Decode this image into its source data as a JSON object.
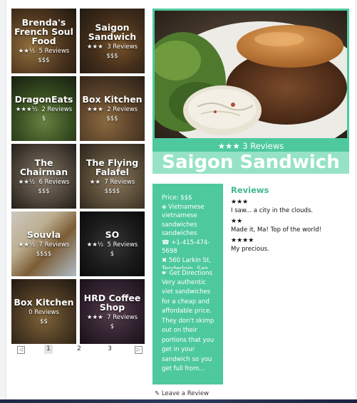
{
  "restaurants": [
    {
      "name": "Brenda's French Soul Food",
      "stars": "★★½",
      "reviews": "5 Reviews",
      "price": "$$$"
    },
    {
      "name": "Saigon Sandwich",
      "stars": "★★★",
      "reviews": "3 Reviews",
      "price": "$$$"
    },
    {
      "name": "DragonEats",
      "stars": "★★★½",
      "reviews": "2 Reviews",
      "price": "$"
    },
    {
      "name": "Box Kitchen",
      "stars": "★★★",
      "reviews": "2 Reviews",
      "price": "$$$"
    },
    {
      "name": "The Chairman",
      "stars": "★★½",
      "reviews": "6 Reviews",
      "price": "$$$"
    },
    {
      "name": "The Flying Falafel",
      "stars": "★★",
      "reviews": "7 Reviews",
      "price": "$$$$"
    },
    {
      "name": "Souvla",
      "stars": "★★½",
      "reviews": "7 Reviews",
      "price": "$$$$"
    },
    {
      "name": "SO",
      "stars": "★★½",
      "reviews": "5 Reviews",
      "price": "$"
    },
    {
      "name": "Box Kitchen",
      "stars": "",
      "reviews": "0 Reviews",
      "price": "$$"
    },
    {
      "name": "HRD Coffee Shop",
      "stars": "★★★",
      "reviews": "7 Reviews",
      "price": "$"
    }
  ],
  "pagination": {
    "prev": "◁",
    "pages": [
      "1",
      "2",
      "3"
    ],
    "next": "▷",
    "active": "1"
  },
  "selected": {
    "rating": "★★★ 3 Reviews",
    "name": "Saigon Sandwich",
    "price": "Price: $$$",
    "category": "◈ Vietnamese",
    "category_sub": "vietnamese",
    "category_sub2": "sandwiches",
    "category_sub3": "sandwiches",
    "phone": "☎ +1-415-474-",
    "phone2": "5698",
    "address": "✖ 560 Larkin St,",
    "address2": "Tenderloin, San",
    "directions": "☛ Get Directions",
    "description": "Very authentic viet sandwiches for a cheap and affordable price. They don't skimp out on their portions that you get in your sandwich so you get full from..."
  },
  "reviews": {
    "heading": "Reviews",
    "items": [
      {
        "stars": "★★★",
        "text": "I saw... a city in the clouds."
      },
      {
        "stars": "★★",
        "text": "Made it, Ma! Top of the world!"
      },
      {
        "stars": "★★★★",
        "text": "My precious."
      }
    ]
  },
  "leave_review": "✎ Leave a Review"
}
